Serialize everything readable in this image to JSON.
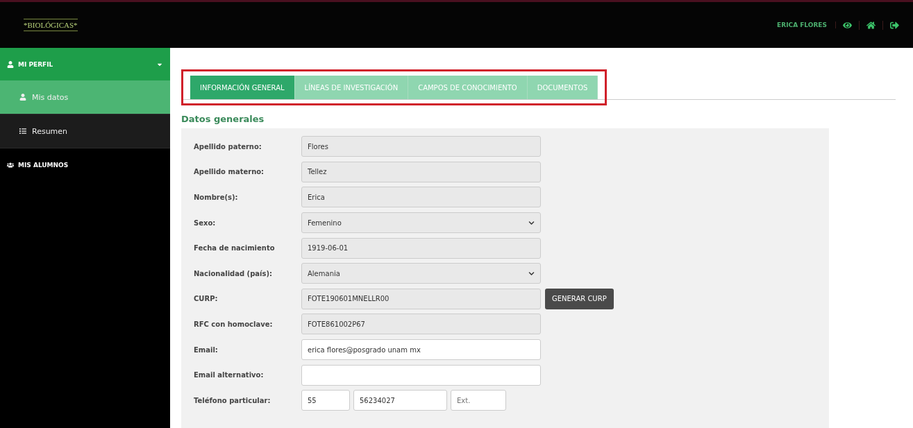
{
  "header": {
    "logo": "*BIOLÓGICAS*",
    "user": "ERICA FLORES"
  },
  "sidebar": {
    "items": [
      {
        "label": "MI PERFIL",
        "expanded": true,
        "children": [
          {
            "label": "Mis datos",
            "selected": true
          },
          {
            "label": "Resumen",
            "selected": false
          }
        ]
      },
      {
        "label": "MIS ALUMNOS",
        "expanded": false
      }
    ]
  },
  "tabs": [
    {
      "label": "INFORMACIÓN GENERAL",
      "selected": true
    },
    {
      "label": "LÍNEAS DE INVESTIGACIÓN",
      "selected": false
    },
    {
      "label": "CAMPOS DE CONOCIMIENTO",
      "selected": false
    },
    {
      "label": "DOCUMENTOS",
      "selected": false
    }
  ],
  "section_title": "Datos generales",
  "fields": [
    {
      "label": "Apellido paterno:",
      "kind": "text",
      "value": "Flores",
      "disabled": true
    },
    {
      "label": "Apellido materno:",
      "kind": "text",
      "value": "Tellez",
      "disabled": true
    },
    {
      "label": "Nombre(s):",
      "kind": "text",
      "value": "Erica",
      "disabled": true
    },
    {
      "label": "Sexo:",
      "kind": "select",
      "value": "Femenino",
      "disabled": true
    },
    {
      "label": "Fecha de nacimiento",
      "kind": "text",
      "value": "1919-06-01",
      "disabled": true
    },
    {
      "label": "Nacionalidad (país):",
      "kind": "select",
      "value": "Alemania",
      "disabled": true
    },
    {
      "label": "CURP:",
      "kind": "text",
      "value": "FOTE190601MNELLR00",
      "disabled": true,
      "button": "GENERAR CURP"
    },
    {
      "label": "RFC con homoclave:",
      "kind": "text",
      "value": "FOTE861002P67",
      "disabled": true
    },
    {
      "label": "Email:",
      "kind": "text",
      "value": "erica flores@posgrado unam mx",
      "disabled": false
    },
    {
      "label": "Email alternativo:",
      "kind": "text",
      "disabled": false
    },
    {
      "label": "Teléfono particular:",
      "kind": "phone",
      "parts": [
        {
          "value": "55"
        },
        {
          "value": "56234027"
        },
        {
          "placeholder": "Ext."
        }
      ],
      "disabled": false
    }
  ]
}
